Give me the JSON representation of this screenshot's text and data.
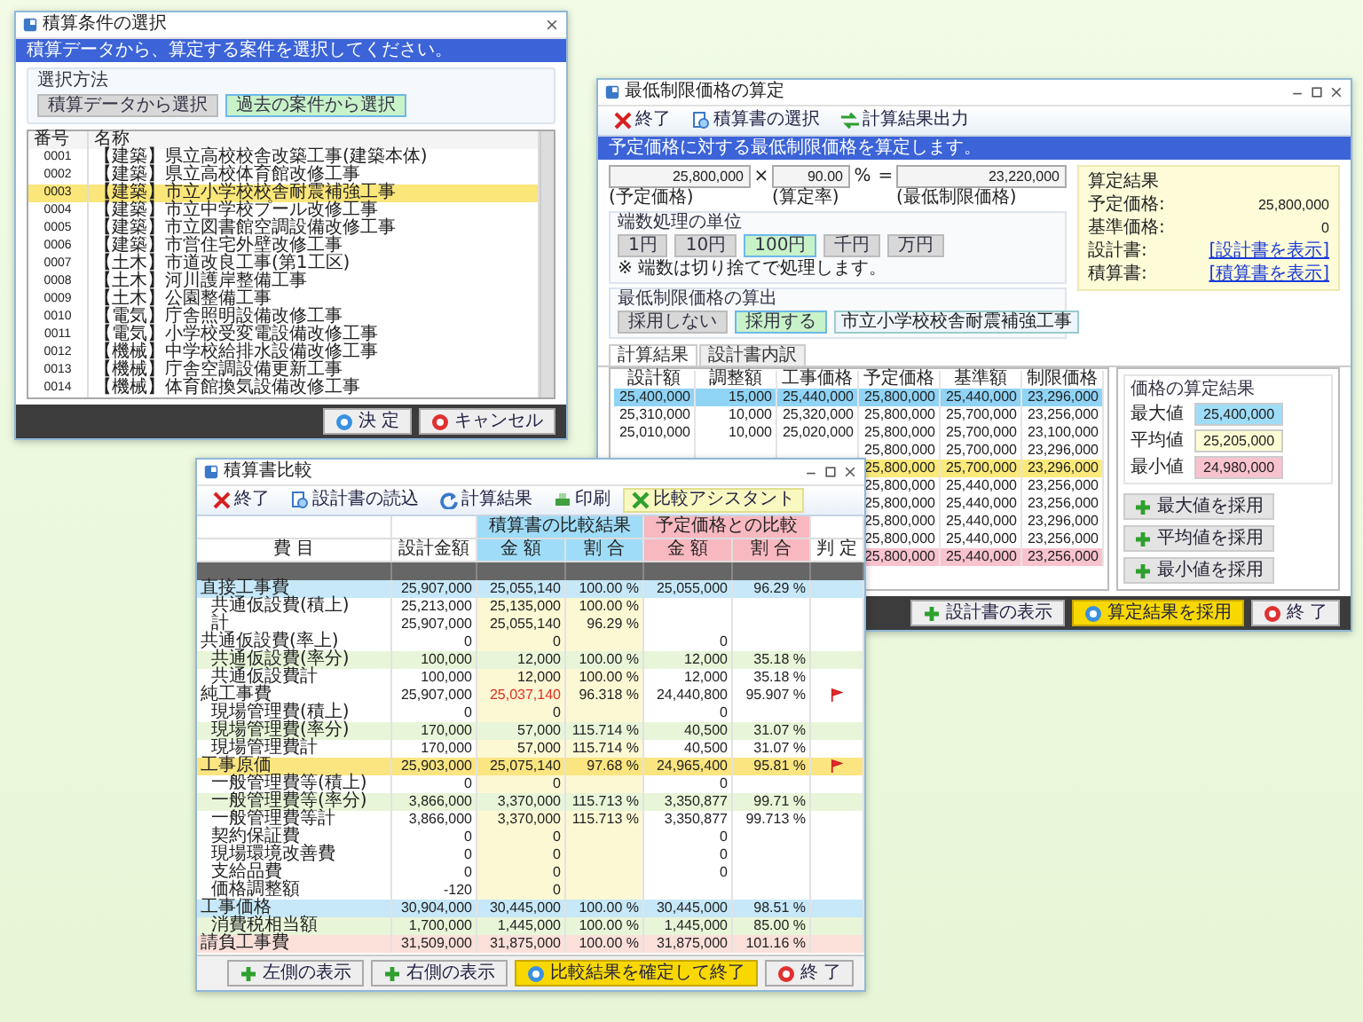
{
  "condition_window": {
    "title": "積算条件の選択",
    "banner": "積算データから、算定する案件を選択してください。",
    "group_label": "選択方法",
    "choices": [
      {
        "label": "積算データから選択",
        "selected": false
      },
      {
        "label": "過去の案件から選択",
        "selected": true
      }
    ],
    "columns": [
      "番号",
      "名称"
    ],
    "rows": [
      {
        "code": "0001",
        "name": "【建築】県立高校校舎改築工事(建築本体)",
        "selected": false
      },
      {
        "code": "0002",
        "name": "【建築】県立高校体育館改修工事",
        "selected": false
      },
      {
        "code": "0003",
        "name": "【建築】市立小学校校舎耐震補強工事",
        "selected": true
      },
      {
        "code": "0004",
        "name": "【建築】市立中学校プール改修工事",
        "selected": false
      },
      {
        "code": "0005",
        "name": "【建築】市立図書館空調設備改修工事",
        "selected": false
      },
      {
        "code": "0006",
        "name": "【建築】市営住宅外壁改修工事",
        "selected": false
      },
      {
        "code": "0007",
        "name": "【土木】市道改良工事(第1工区)",
        "selected": false
      },
      {
        "code": "0008",
        "name": "【土木】河川護岸整備工事",
        "selected": false
      },
      {
        "code": "0009",
        "name": "【土木】公園整備工事",
        "selected": false
      },
      {
        "code": "0010",
        "name": "【電気】庁舎照明設備改修工事",
        "selected": false
      },
      {
        "code": "0011",
        "name": "【電気】小学校受変電設備改修工事",
        "selected": false
      },
      {
        "code": "0012",
        "name": "【機械】中学校給排水設備改修工事",
        "selected": false
      },
      {
        "code": "0013",
        "name": "【機械】庁舎空調設備更新工事",
        "selected": false
      },
      {
        "code": "0014",
        "name": "【機械】体育館換気設備改修工事",
        "selected": false
      }
    ],
    "buttons": [
      {
        "label": "決 定",
        "kind": "ok"
      },
      {
        "label": "キャンセル",
        "kind": "cancel"
      }
    ]
  },
  "calc_window": {
    "title": "最低制限価格の算定",
    "toolbar": [
      {
        "label": "終了",
        "kind": "close"
      },
      {
        "label": "積算書の選択",
        "kind": "document"
      },
      {
        "label": "計算結果出力",
        "kind": "arrows"
      }
    ],
    "banner": "予定価格に対する最低制限価格を算定します。",
    "base_value": "25,800,000",
    "times": "×",
    "rate": "90.00",
    "rate_unit": "%",
    "equals": "=",
    "result": "23,220,000",
    "input_labels": [
      "(予定価格)",
      "(算定率)",
      "(最低制限価格)"
    ],
    "info": {
      "title": "算定結果",
      "rows": [
        {
          "label": "予定価格:",
          "value": "25,800,000",
          "kind": "value"
        },
        {
          "label": "基準価格:",
          "value": "0",
          "kind": "value"
        },
        {
          "label": "設計書:",
          "value": "[設計書を表示]",
          "kind": "link"
        },
        {
          "label": "積算書:",
          "value": "[積算書を表示]",
          "kind": "link"
        }
      ]
    },
    "round_group": {
      "label": "端数処理の単位",
      "options": [
        {
          "label": "1円",
          "selected": false
        },
        {
          "label": "10円",
          "selected": false
        },
        {
          "label": "100円",
          "selected": true
        },
        {
          "label": "千円",
          "selected": false
        },
        {
          "label": "万円",
          "selected": false
        }
      ],
      "note": "※ 端数は切り捨てで処理します。"
    },
    "apply_group": {
      "label": "最低制限価格の算出",
      "options": [
        {
          "label": "採用しない",
          "selected": false
        },
        {
          "label": "採用する",
          "selected": true
        }
      ],
      "field": "市立小学校校舎耐震補強工事"
    },
    "tabs": [
      {
        "label": "計算結果",
        "selected": true
      },
      {
        "label": "設計書内訳",
        "selected": false
      }
    ],
    "columns": [
      "設計額",
      "調整額",
      "工事価格",
      "予定価格",
      "基準額",
      "制限価格"
    ],
    "rows": [
      {
        "cells": [
          "25,400,000",
          "15,000",
          "25,440,000",
          "25,800,000",
          "25,440,000",
          "23,296,000"
        ],
        "color": "#8fd3f5"
      },
      {
        "cells": [
          "25,310,000",
          "10,000",
          "25,320,000",
          "25,800,000",
          "25,700,000",
          "23,256,000"
        ]
      },
      {
        "cells": [
          "25,010,000",
          "10,000",
          "25,020,000",
          "25,800,000",
          "25,700,000",
          "23,100,000"
        ]
      },
      {
        "cells": [
          "",
          "",
          "",
          "25,800,000",
          "25,700,000",
          "23,296,000"
        ]
      },
      {
        "cells": [
          "",
          "",
          "",
          "25,800,000",
          "25,700,000",
          "23,296,000"
        ],
        "color": "#fbe97a"
      },
      {
        "cells": [
          "",
          "",
          "",
          "25,800,000",
          "25,440,000",
          "23,256,000"
        ]
      },
      {
        "cells": [
          "",
          "",
          "",
          "25,800,000",
          "25,440,000",
          "23,256,000"
        ]
      },
      {
        "cells": [
          "",
          "",
          "",
          "25,800,000",
          "25,440,000",
          "23,296,000"
        ]
      },
      {
        "cells": [
          "",
          "",
          "",
          "25,800,000",
          "25,440,000",
          "23,256,000"
        ]
      },
      {
        "cells": [
          "",
          "",
          "",
          "25,800,000",
          "25,440,000",
          "23,256,000"
        ],
        "color": "#f8c3cf"
      }
    ],
    "stats": {
      "title": "価格の算定結果",
      "items": [
        {
          "label": "最大値",
          "value": "25,400,000",
          "color": "#9fdcf7"
        },
        {
          "label": "平均値",
          "value": "25,205,000",
          "color": "#fdfbd3"
        },
        {
          "label": "最小値",
          "value": "24,980,000",
          "color": "#f8c3cf"
        }
      ]
    },
    "actions": [
      "最大値を採用",
      "平均値を採用",
      "最小値を採用"
    ],
    "buttons": [
      {
        "label": "設計書の表示",
        "kind": "plus",
        "highlighted": false
      },
      {
        "label": "算定結果を採用",
        "kind": "ok",
        "highlighted": true
      },
      {
        "label": "終 了",
        "kind": "cancel",
        "highlighted": false
      }
    ]
  },
  "compare_window": {
    "title": "積算書比較",
    "toolbar": [
      {
        "label": "終了",
        "kind": "close",
        "selected": false
      },
      {
        "label": "設計書の読込",
        "kind": "document",
        "selected": false
      },
      {
        "label": "計算結果",
        "kind": "refresh",
        "selected": false
      },
      {
        "label": "印刷",
        "kind": "print",
        "selected": false
      },
      {
        "label": "比較アシスタント",
        "kind": "sheet",
        "selected": true
      }
    ],
    "header_groups": [
      {
        "label": "積算書の比較結果",
        "color": "#9fdcf7"
      },
      {
        "label": "予定価格との比較",
        "color": "#f8b8c0"
      }
    ],
    "columns": [
      "費 目",
      "設計金額",
      "金 額",
      "割 合",
      "金 額",
      "割 合",
      "判 定"
    ],
    "rows": [
      {
        "cells": [
          "直接工事費",
          "25,907,000",
          "25,055,140",
          "100.00 %",
          "25,055,000",
          "96.29 %"
        ],
        "color": "#c6e8f8",
        "indent": false,
        "alert": false,
        "flag": false
      },
      {
        "cells": [
          "共通仮設費(積上)",
          "25,213,000",
          "25,135,000",
          "100.00 %",
          "",
          ""
        ],
        "indent": true,
        "alert": false,
        "flag": false
      },
      {
        "cells": [
          "計",
          "25,907,000",
          "25,055,140",
          "96.29 %",
          "",
          ""
        ],
        "indent": true,
        "alert": false,
        "flag": false
      },
      {
        "cells": [
          "共通仮設費(率上)",
          "0",
          "0",
          "",
          "0",
          ""
        ],
        "indent": false,
        "alert": false,
        "flag": false
      },
      {
        "cells": [
          "共通仮設費(率分)",
          "100,000",
          "12,000",
          "100.00 %",
          "12,000",
          "35.18 %"
        ],
        "color": "#e8f5d8",
        "indent": true,
        "alert": false,
        "flag": false
      },
      {
        "cells": [
          "共通仮設費計",
          "100,000",
          "12,000",
          "100.00 %",
          "12,000",
          "35.18 %"
        ],
        "indent": true,
        "alert": false,
        "flag": false
      },
      {
        "cells": [
          "純工事費",
          "25,907,000",
          "25,037,140",
          "96.318 %",
          "24,440,800",
          "95.907 %"
        ],
        "indent": false,
        "alert": true,
        "flag": true
      },
      {
        "cells": [
          "現場管理費(積上)",
          "0",
          "0",
          "",
          "0",
          ""
        ],
        "indent": true,
        "alert": false,
        "flag": false
      },
      {
        "cells": [
          "現場管理費(率分)",
          "170,000",
          "57,000",
          "115.714 %",
          "40,500",
          "31.07 %"
        ],
        "color": "#e8f5d8",
        "indent": true,
        "alert": false,
        "flag": false
      },
      {
        "cells": [
          "現場管理費計",
          "170,000",
          "57,000",
          "115.714 %",
          "40,500",
          "31.07 %"
        ],
        "indent": true,
        "alert": false,
        "flag": false
      },
      {
        "cells": [
          "工事原価",
          "25,903,000",
          "25,075,140",
          "97.68 %",
          "24,965,400",
          "95.81 %"
        ],
        "color": "#fbe580",
        "indent": false,
        "alert": false,
        "flag": true
      },
      {
        "cells": [
          "一般管理費等(積上)",
          "0",
          "0",
          "",
          "0",
          ""
        ],
        "indent": true,
        "alert": false,
        "flag": false
      },
      {
        "cells": [
          "一般管理費等(率分)",
          "3,866,000",
          "3,370,000",
          "115.713 %",
          "3,350,877",
          "99.71 %"
        ],
        "color": "#e8f5d8",
        "indent": true,
        "alert": false,
        "flag": false
      },
      {
        "cells": [
          "一般管理費等計",
          "3,866,000",
          "3,370,000",
          "115.713 %",
          "3,350,877",
          "99.713 %"
        ],
        "indent": true,
        "alert": false,
        "flag": false
      },
      {
        "cells": [
          "契約保証費",
          "0",
          "0",
          "",
          "0",
          ""
        ],
        "indent": true,
        "alert": false,
        "flag": false
      },
      {
        "cells": [
          "現場環境改善費",
          "0",
          "0",
          "",
          "0",
          ""
        ],
        "indent": true,
        "alert": false,
        "flag": false
      },
      {
        "cells": [
          "支給品費",
          "0",
          "0",
          "",
          "0",
          ""
        ],
        "indent": true,
        "alert": false,
        "flag": false
      },
      {
        "cells": [
          "価格調整額",
          "-120",
          "0",
          "",
          "",
          ""
        ],
        "indent": true,
        "alert": false,
        "flag": false
      },
      {
        "cells": [
          "工事価格",
          "30,904,000",
          "30,445,000",
          "100.00 %",
          "30,445,000",
          "98.51 %"
        ],
        "color": "#c6e8f8",
        "indent": false,
        "alert": false,
        "flag": false
      },
      {
        "cells": [
          "消費税相当額",
          "1,700,000",
          "1,445,000",
          "100.00 %",
          "1,445,000",
          "85.00 %"
        ],
        "color": "#e8f5d8",
        "indent": true,
        "alert": false,
        "flag": false
      },
      {
        "cells": [
          "請負工事費",
          "31,509,000",
          "31,875,000",
          "100.00 %",
          "31,875,000",
          "101.16 %"
        ],
        "color": "#fbe0da",
        "indent": false,
        "alert": false,
        "flag": false
      }
    ],
    "buttons": [
      {
        "label": "左側の表示",
        "kind": "plus",
        "highlighted": false
      },
      {
        "label": "右側の表示",
        "kind": "plus",
        "highlighted": false
      },
      {
        "label": "比較結果を確定して終了",
        "kind": "ok",
        "highlighted": true
      },
      {
        "label": "終 了",
        "kind": "cancel",
        "highlighted": false
      }
    ]
  }
}
